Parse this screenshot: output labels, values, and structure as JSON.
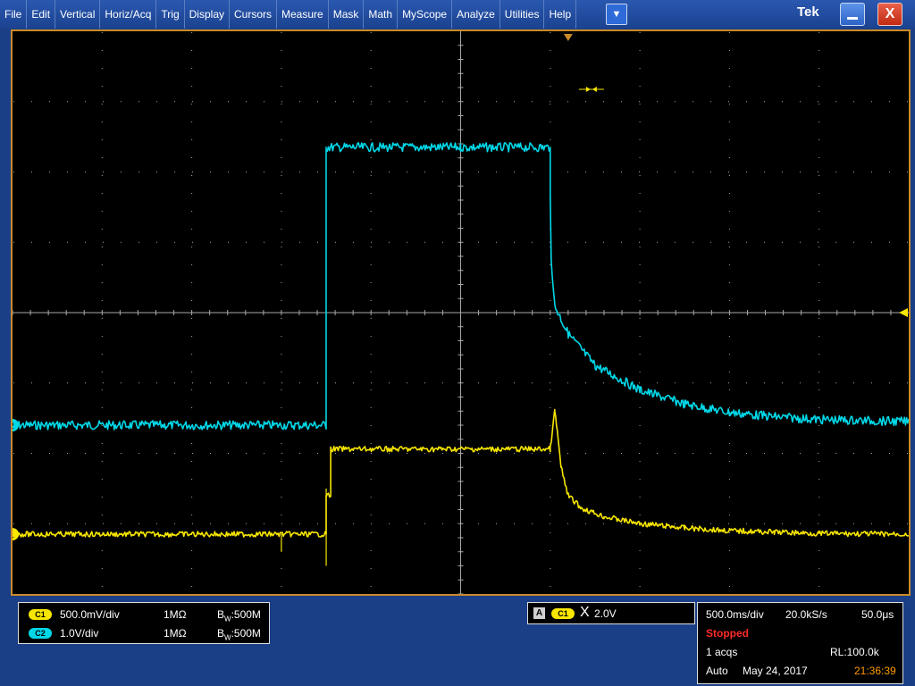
{
  "menu": [
    "File",
    "Edit",
    "Vertical",
    "Horiz/Acq",
    "Trig",
    "Display",
    "Cursors",
    "Measure",
    "Mask",
    "Math",
    "MyScope",
    "Analyze",
    "Utilities",
    "Help"
  ],
  "window": {
    "brand": "Tek",
    "dropdown_icon": "chevron-down-icon",
    "minimize_icon": "minimize-icon",
    "close_icon": "close-icon",
    "close_glyph": "X"
  },
  "colors": {
    "ch1": "#f7e600",
    "ch2": "#00d8e8",
    "graticule": "#a8a8a8",
    "border": "#c98a28",
    "stopped": "#ff2a2a",
    "time": "#ff9a00"
  },
  "channels": [
    {
      "badge": "C1",
      "scale": "500.0mV/div",
      "impedance": "1MΩ",
      "bw_prefix": "B",
      "bw_sub": "W",
      "bw_value": ":500M",
      "marker": "1"
    },
    {
      "badge": "C2",
      "scale": "1.0V/div",
      "impedance": "1MΩ",
      "bw_prefix": "B",
      "bw_sub": "W",
      "bw_value": ":500M",
      "marker": "2"
    }
  ],
  "trigger": {
    "mode": "A",
    "source": "C1",
    "edge_icon": "trigger-edge-icon",
    "level": "2.0V"
  },
  "horizontal": {
    "scale": "500.0ms/div",
    "sample_rate": "20.0kS/s",
    "resolution": "50.0μs",
    "state": "Stopped",
    "acqs": "1 acqs",
    "record_length": "RL:100.0k",
    "trigger_mode": "Auto",
    "date": "May 24, 2017",
    "time": "21:36:39"
  },
  "chart_data": {
    "type": "line",
    "x_unit": "div",
    "y_unit": "div",
    "xlim": [
      -5,
      5
    ],
    "ylim": [
      -4,
      4
    ],
    "grid": true,
    "series": [
      {
        "name": "C1",
        "x": [
          -5.0,
          -1.5,
          -1.5,
          -1.45,
          -1.45,
          1.0,
          1.0,
          1.05,
          1.08,
          1.12,
          1.2,
          1.35,
          1.6,
          2.0,
          2.5,
          3.0,
          3.5,
          4.0,
          5.0
        ],
        "y": [
          -3.15,
          -3.15,
          -2.6,
          -2.6,
          -1.94,
          -1.94,
          -1.94,
          -1.4,
          -1.7,
          -2.2,
          -2.6,
          -2.78,
          -2.9,
          -3.0,
          -3.06,
          -3.1,
          -3.12,
          -3.14,
          -3.15
        ]
      },
      {
        "name": "C2",
        "x": [
          -5.0,
          -1.5,
          -1.5,
          0.0,
          1.0,
          1.0,
          1.01,
          1.05,
          1.2,
          1.5,
          2.0,
          2.5,
          3.0,
          3.5,
          4.0,
          5.0
        ],
        "y": [
          -1.6,
          -1.6,
          2.35,
          2.35,
          2.35,
          1.6,
          0.8,
          0.1,
          -0.3,
          -0.75,
          -1.1,
          -1.3,
          -1.42,
          -1.48,
          -1.52,
          -1.55
        ]
      }
    ],
    "ch1_spikes": [
      {
        "x": -1.5,
        "y_top": -2.5,
        "y_bottom": -3.6
      },
      {
        "x": -2.0,
        "y_top": -3.15,
        "y_bottom": -3.4
      }
    ],
    "trigger_position_x": 1.2,
    "trigger_level_y": 0.0
  }
}
